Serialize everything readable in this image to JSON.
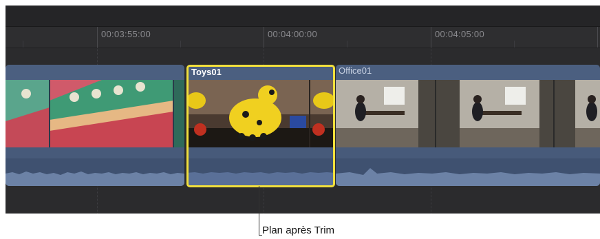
{
  "ruler": {
    "timecodes": [
      "00:03:55:00",
      "00:04:00:00",
      "00:04:05:00"
    ]
  },
  "clips": {
    "left_clip": {
      "title": ""
    },
    "toys01": {
      "title": "Toys01"
    },
    "office01": {
      "title": "Office01"
    }
  },
  "selection_color": "#f2e03c",
  "callout": {
    "text": "Plan après Trim"
  }
}
